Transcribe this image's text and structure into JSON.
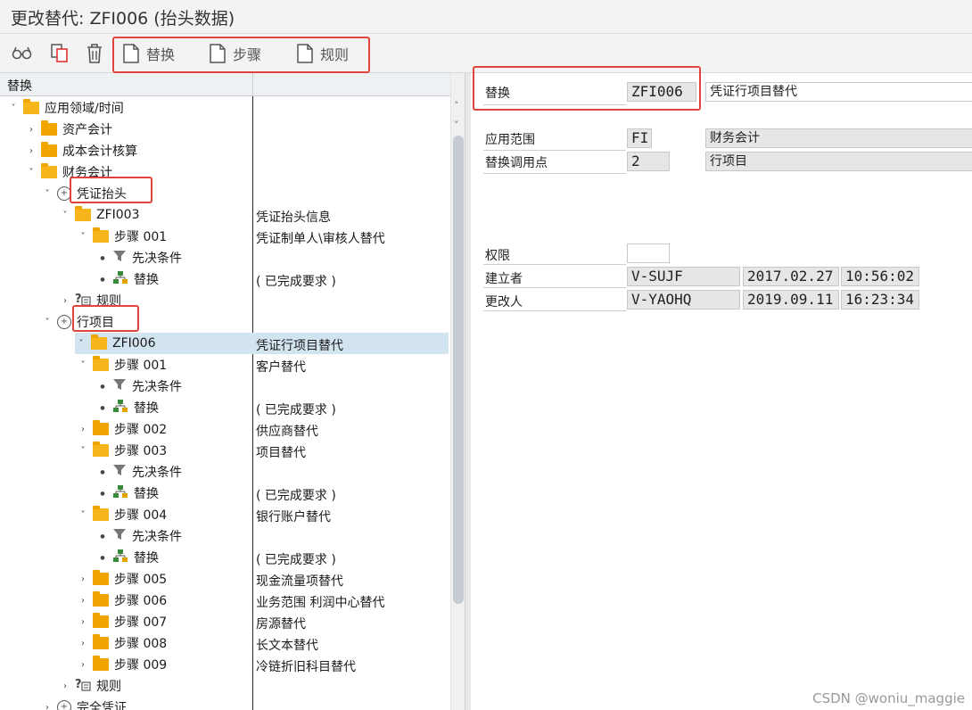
{
  "window": {
    "title": "更改替代: ZFI006 (抬头数据)"
  },
  "toolbar": {
    "icons": [
      "glasses-icon",
      "copy-icon",
      "trash-icon"
    ],
    "buttons": [
      {
        "label": "替换"
      },
      {
        "label": "步骤"
      },
      {
        "label": "规则"
      }
    ]
  },
  "tree": {
    "header": "替换",
    "rows": [
      {
        "label": "应用领域/时间",
        "desc": ""
      },
      {
        "label": "资产会计",
        "desc": ""
      },
      {
        "label": "成本会计核算",
        "desc": ""
      },
      {
        "label": "财务会计",
        "desc": ""
      },
      {
        "label": "凭证抬头",
        "desc": ""
      },
      {
        "label": "ZFI003",
        "desc": "凭证抬头信息"
      },
      {
        "label": "步骤 001",
        "desc": "凭证制单人\\审核人替代"
      },
      {
        "label": "先决条件",
        "desc": ""
      },
      {
        "label": "替换",
        "desc": "( 已完成要求 )"
      },
      {
        "label": "规则",
        "desc": ""
      },
      {
        "label": "行项目",
        "desc": ""
      },
      {
        "label": "ZFI006",
        "desc": "凭证行项目替代"
      },
      {
        "label": "步骤 001",
        "desc": "客户替代"
      },
      {
        "label": "先决条件",
        "desc": ""
      },
      {
        "label": "替换",
        "desc": "( 已完成要求 )"
      },
      {
        "label": "步骤 002",
        "desc": "供应商替代"
      },
      {
        "label": "步骤 003",
        "desc": "项目替代"
      },
      {
        "label": "先决条件",
        "desc": ""
      },
      {
        "label": "替换",
        "desc": "( 已完成要求 )"
      },
      {
        "label": "步骤 004",
        "desc": "银行账户替代"
      },
      {
        "label": "先决条件",
        "desc": ""
      },
      {
        "label": "替换",
        "desc": "( 已完成要求 )"
      },
      {
        "label": "步骤 005",
        "desc": "现金流量项替代"
      },
      {
        "label": "步骤 006",
        "desc": "业务范围 利润中心替代"
      },
      {
        "label": "步骤 007",
        "desc": "房源替代"
      },
      {
        "label": "步骤 008",
        "desc": "长文本替代"
      },
      {
        "label": "步骤 009",
        "desc": "冷链折旧科目替代"
      },
      {
        "label": "规则",
        "desc": ""
      },
      {
        "label": "完全凭证",
        "desc": ""
      }
    ]
  },
  "details": {
    "substitution_label": "替换",
    "substitution_code": "ZFI006",
    "substitution_text": "凭证行项目替代",
    "app_area_label": "应用范围",
    "app_area_code": "FI",
    "app_area_text": "财务会计",
    "call_point_label": "替换调用点",
    "call_point_code": "2",
    "call_point_text": "行项目",
    "auth_label": "权限",
    "auth_value": "",
    "created_by_label": "建立者",
    "created_by": "V-SUJF",
    "created_date": "2017.02.27",
    "created_time": "10:56:02",
    "changed_by_label": "更改人",
    "changed_by": "V-YAOHQ",
    "changed_date": "2019.09.11",
    "changed_time": "16:23:34"
  },
  "watermark": "CSDN @woniu_maggie"
}
